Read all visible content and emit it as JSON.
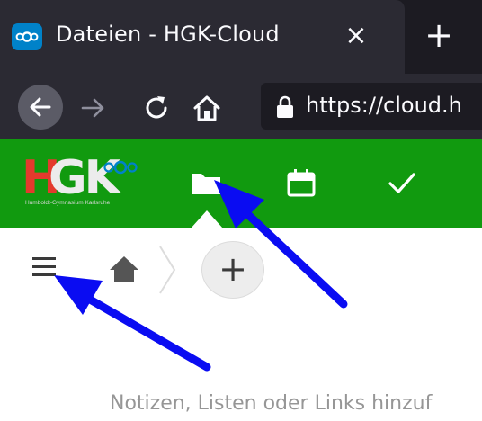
{
  "browser": {
    "tab": {
      "title": "Dateien - HGK-Cloud",
      "close_label": "×",
      "favicon": "nextcloud-logo-icon"
    },
    "new_tab_label": "+",
    "address": {
      "url": "https://cloud.h",
      "lock_icon": "lock-icon"
    },
    "buttons": [
      "back-arrow-icon",
      "forward-arrow-icon",
      "reload-icon",
      "home-icon"
    ]
  },
  "app": {
    "logo": {
      "letters_h": "H",
      "letters_gk": "GK",
      "subtitle": "Humboldt-Gymnasium Karlsruhe"
    },
    "nav": [
      {
        "name": "files",
        "icon": "folder-icon",
        "active": true
      },
      {
        "name": "calendar",
        "icon": "calendar-icon",
        "active": false
      },
      {
        "name": "tasks",
        "icon": "checkmark-icon",
        "active": false
      }
    ],
    "header_color": "#119a0f",
    "logo_red": "#e43a2d",
    "logo_blue": "#0082c9"
  },
  "toolbar": {
    "menu_icon": "hamburger-menu-icon",
    "breadcrumb_home_icon": "home-icon",
    "add_label": "+"
  },
  "content": {
    "hint_text": "Notizen, Listen oder Links hinzuf"
  },
  "annotations": {
    "arrow_color": "#0a0cf2",
    "arrows": [
      "arrow-to-files-icon",
      "arrow-to-menu-icon"
    ]
  }
}
